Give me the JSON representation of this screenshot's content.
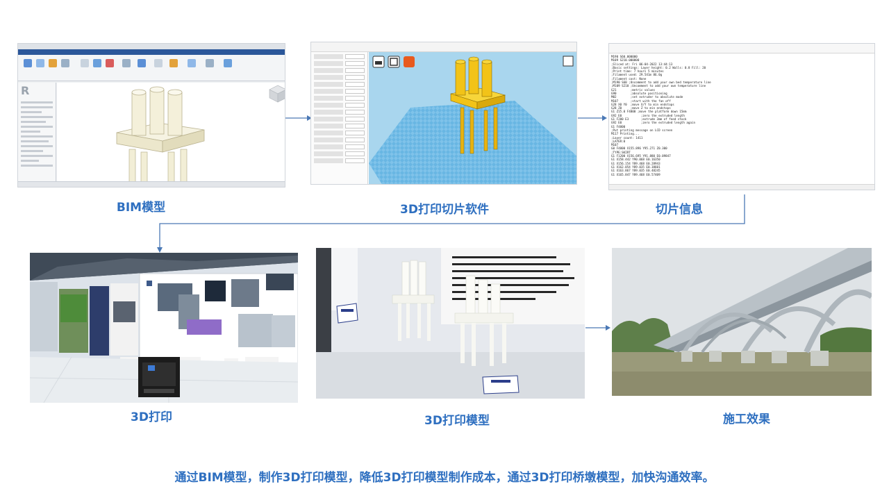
{
  "steps": {
    "bim": {
      "caption": "BIM模型"
    },
    "slicer": {
      "caption": "3D打印切片软件"
    },
    "gcode": {
      "caption": "切片信息",
      "lines": [
        "M190 S60.000000",
        "M109 S210.000000",
        ";Sliced at: Fri 06-04-2022 13:44:13",
        ";Basic settings: Layer height: 0.2 Walls: 0.8 Fill: 20",
        ";Print time: 7 hours 5 minutes",
        ";Filament used: 29.541m 86.0g",
        ";Filament cost: None",
        ";M190 S60 ;Uncomment to add your own bed temperature line",
        ";M109 S210 ;Uncomment to add your own temperature line",
        "G21        ;metric values",
        "G90        ;absolute positioning",
        "M82        ;set extruder to absolute mode",
        "M107       ;start with the fan off",
        "G28 X0 Y0  ;move X/Y to min endstops",
        "G28 Z0     ;move Z to min endstops",
        "G1 Z15.0 F4800 ;move the platform down 15mm",
        "G92 E0           ;zero the extruded length",
        "G1 F200 E3       ;extrude 3mm of feed stock",
        "G92 E0           ;zero the extruded length again",
        "G1 F4800",
        ";Put printing message on LCD screen",
        "M117 Printing...",
        "",
        ";Layer count: 1411",
        ";LAYER:0",
        "M107",
        "G0 F4800 X155.896 Y95.271 Z0.300",
        ";TYPE:SKIRT",
        "G1 F1200 X156.695 Y91.880 E0.09847",
        "G1 X158.442 Y90.068 E0.16350",
        "G1 X156.154 Y89.468 E0.28943",
        "G1 X162.054 Y89.035 E0.38601",
        "G1 X163.867 Y89.035 E0.48245",
        "G1 X165.847 Y89.468 E0.57409"
      ]
    },
    "printing": {
      "caption": "3D打印"
    },
    "printed_model": {
      "caption": "3D打印模型"
    },
    "construction": {
      "caption": "施工效果"
    }
  },
  "conclusion": "通过BIM模型，制作3D打印模型，降低3D打印模型制作成本，通过3D打印桥墩模型，加快沟通效率。",
  "colors": {
    "accent": "#2e6fc0",
    "arrow": "#4a78b5",
    "slicer_bg": "#a9d6ee",
    "model_yellow": "#f2c318"
  }
}
